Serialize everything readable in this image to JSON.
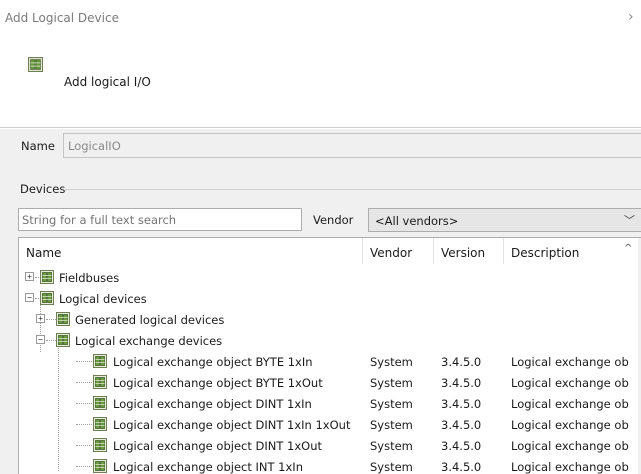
{
  "window": {
    "title": "Add Logical Device",
    "close_glyph": "›"
  },
  "header": {
    "icon": "device-module-icon",
    "text": "Add logical I/O"
  },
  "name_field": {
    "label": "Name",
    "value": "LogicalIO"
  },
  "devices": {
    "label": "Devices",
    "search_placeholder": "String for a full text search",
    "vendor_label": "Vendor",
    "vendor_selected": "<All vendors>"
  },
  "table": {
    "columns": [
      "Name",
      "Vendor",
      "Version",
      "Description"
    ],
    "rows": [
      {
        "name": "Fieldbuses",
        "vendor": "",
        "version": "",
        "description": "",
        "expander": "+"
      },
      {
        "name": "Logical devices",
        "vendor": "",
        "version": "",
        "description": "",
        "expander": "−"
      },
      {
        "name": "Generated logical devices",
        "vendor": "",
        "version": "",
        "description": "",
        "expander": "+"
      },
      {
        "name": "Logical exchange devices",
        "vendor": "",
        "version": "",
        "description": "",
        "expander": "−"
      },
      {
        "name": "Logical exchange object BYTE 1xIn",
        "vendor": "System",
        "version": "3.4.5.0",
        "description": "Logical exchange ob",
        "expander": ""
      },
      {
        "name": "Logical exchange object BYTE 1xOut",
        "vendor": "System",
        "version": "3.4.5.0",
        "description": "Logical exchange ob",
        "expander": ""
      },
      {
        "name": "Logical exchange object DINT 1xIn",
        "vendor": "System",
        "version": "3.4.5.0",
        "description": "Logical exchange ob",
        "expander": ""
      },
      {
        "name": "Logical exchange object DINT 1xIn 1xOut",
        "vendor": "System",
        "version": "3.4.5.0",
        "description": "Logical exchange ob",
        "expander": ""
      },
      {
        "name": "Logical exchange object DINT 1xOut",
        "vendor": "System",
        "version": "3.4.5.0",
        "description": "Logical exchange ob",
        "expander": ""
      },
      {
        "name": "Logical exchange object INT 1xIn",
        "vendor": "System",
        "version": "3.4.5.0",
        "description": "Logical exchange ob",
        "expander": ""
      }
    ]
  },
  "colors": {
    "background": "#f0f0f0",
    "icon_green": "#5e8f3f",
    "border": "#adadad"
  }
}
